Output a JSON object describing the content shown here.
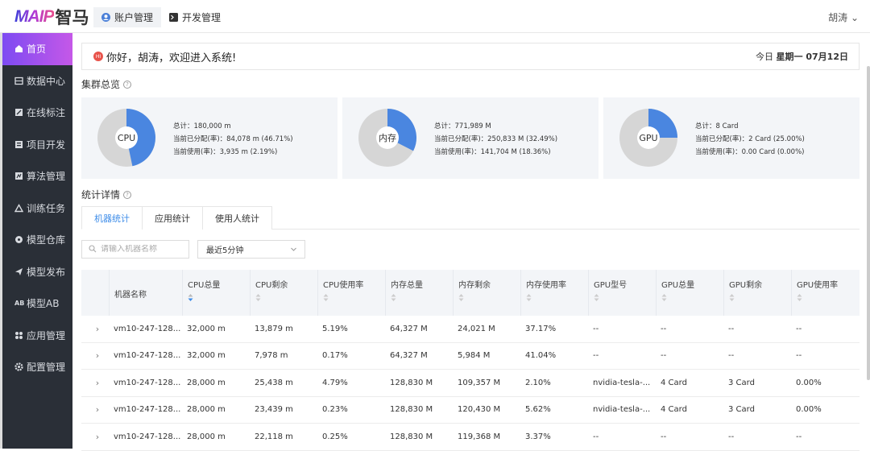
{
  "logo": {
    "brand": "MAIP",
    "cn": "智马"
  },
  "top_tabs": [
    {
      "label": "账户管理"
    },
    {
      "label": "开发管理"
    }
  ],
  "user": "胡涛 ⌄",
  "sidebar": {
    "items": [
      {
        "label": "首页"
      },
      {
        "label": "数据中心"
      },
      {
        "label": "在线标注"
      },
      {
        "label": "项目开发"
      },
      {
        "label": "算法管理"
      },
      {
        "label": "训练任务"
      },
      {
        "label": "模型仓库"
      },
      {
        "label": "模型发布"
      },
      {
        "label": "模型AB"
      },
      {
        "label": "应用管理"
      },
      {
        "label": "配置管理"
      }
    ]
  },
  "welcome": {
    "badge": "HI",
    "greeting": "你好，胡涛，欢迎进入系统!",
    "date_prefix": "今日",
    "date": "星期一 07月12日"
  },
  "overview": {
    "title": "集群总览",
    "help": "?"
  },
  "cards": [
    {
      "name": "CPU",
      "allocated_pct": 46.71,
      "total": "总计：180,000 m",
      "allocated": "当前已分配(率)：84,078 m (46.71%)",
      "used": "当前使用(率)：3,935 m (2.19%)"
    },
    {
      "name": "内存",
      "allocated_pct": 32.49,
      "total": "总计：771,989 M",
      "allocated": "当前已分配(率)：250,833 M (32.49%)",
      "used": "当前使用(率)：141,704 M (18.36%)"
    },
    {
      "name": "GPU",
      "allocated_pct": 25.0,
      "total": "总计：8 Card",
      "allocated": "当前已分配(率)：2 Card (25.00%)",
      "used": "当前使用(率)：0.00 Card (0.00%)"
    }
  ],
  "details": {
    "title": "统计详情",
    "help": "?"
  },
  "tabs": [
    {
      "label": "机器统计"
    },
    {
      "label": "应用统计"
    },
    {
      "label": "使用人统计"
    }
  ],
  "search": {
    "placeholder": "请输入机器名称"
  },
  "time_select": {
    "value": "最近5分钟"
  },
  "colors": {
    "accent": "#3d8ce8",
    "pie_fill": "#4a86e0",
    "pie_rest": "#d6d6d6",
    "active_nav_from": "#7d4bf2",
    "active_nav_to": "#c558e8"
  },
  "table": {
    "headers": [
      "机器名称",
      "CPU总量",
      "CPU剩余",
      "CPU使用率",
      "内存总量",
      "内存剩余",
      "内存使用率",
      "GPU型号",
      "GPU总量",
      "GPU剩余",
      "GPU使用率"
    ],
    "rows": [
      {
        "expand": "›",
        "cells": [
          "vm10-247-128...",
          "32,000 m",
          "13,879 m",
          "5.19%",
          "64,327 M",
          "24,021 M",
          "37.17%",
          "--",
          "--",
          "--",
          "--"
        ]
      },
      {
        "expand": "›",
        "cells": [
          "vm10-247-128...",
          "32,000 m",
          "7,978 m",
          "0.17%",
          "64,327 M",
          "5,984 M",
          "41.04%",
          "--",
          "--",
          "--",
          "--"
        ]
      },
      {
        "expand": "›",
        "cells": [
          "vm10-247-128...",
          "28,000 m",
          "25,438 m",
          "4.79%",
          "128,830 M",
          "109,357 M",
          "2.10%",
          "nvidia-tesla-...",
          "4 Card",
          "3 Card",
          "0.00%"
        ]
      },
      {
        "expand": "›",
        "cells": [
          "vm10-247-128...",
          "28,000 m",
          "23,439 m",
          "0.23%",
          "128,830 M",
          "120,430 M",
          "5.62%",
          "nvidia-tesla-...",
          "4 Card",
          "3 Card",
          "0.00%"
        ]
      },
      {
        "expand": "›",
        "cells": [
          "vm10-247-128...",
          "28,000 m",
          "22,118 m",
          "0.25%",
          "128,830 M",
          "119,368 M",
          "3.37%",
          "--",
          "--",
          "--",
          "--"
        ]
      }
    ]
  }
}
